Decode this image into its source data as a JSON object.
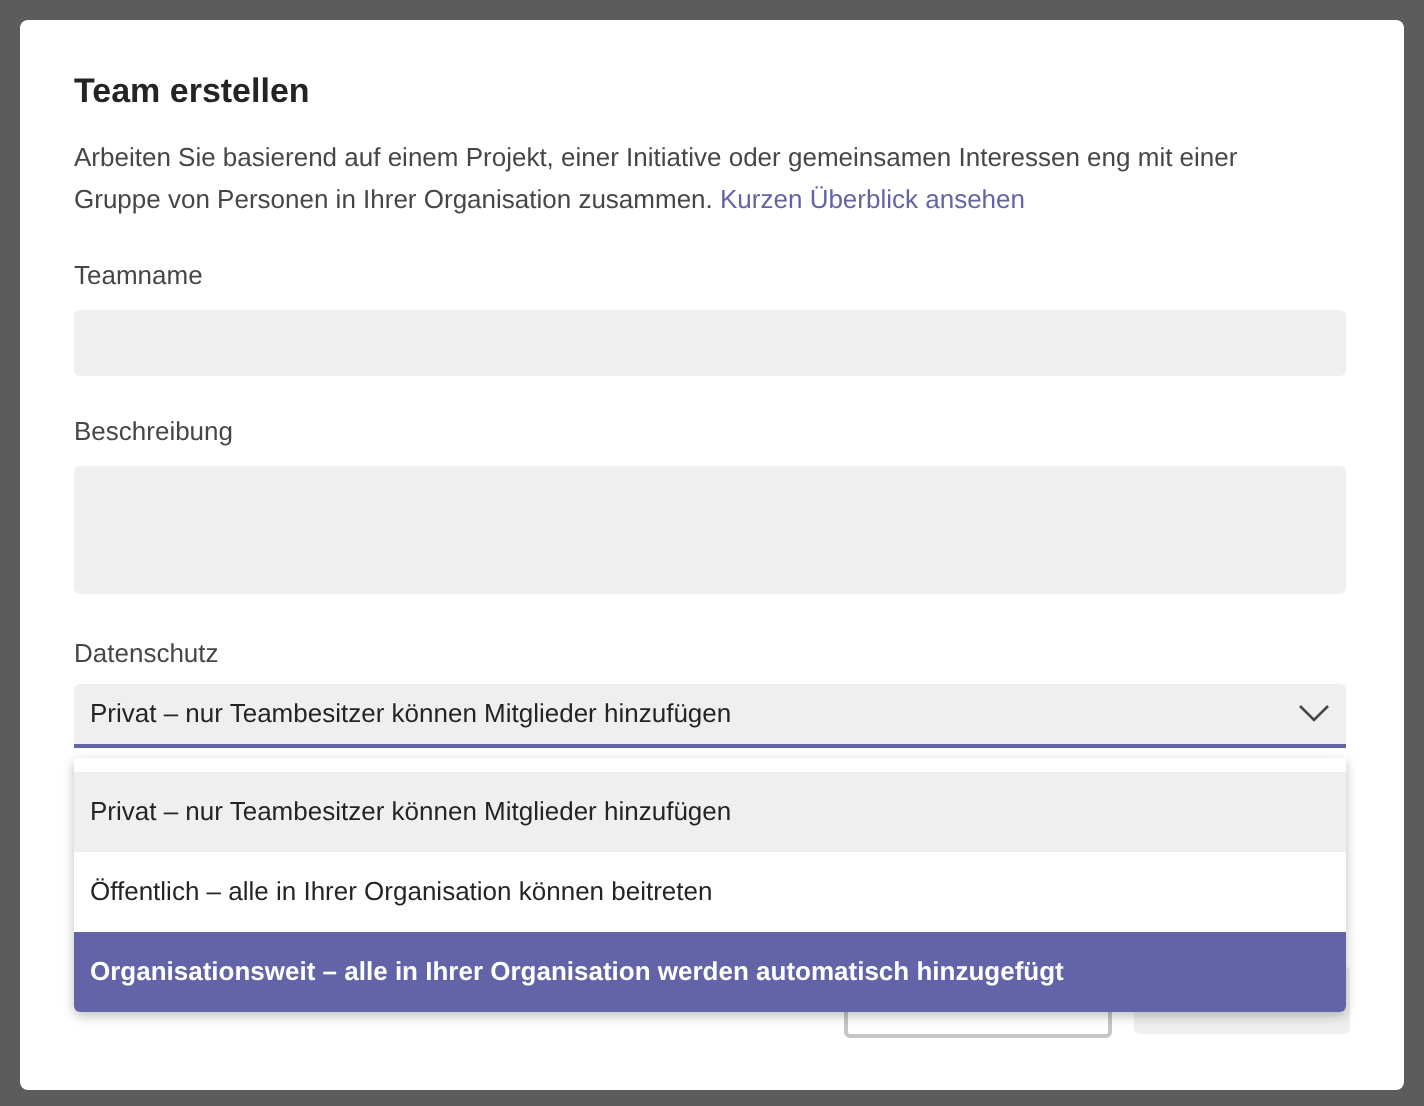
{
  "dialog": {
    "title": "Team erstellen",
    "description": "Arbeiten Sie basierend auf einem Projekt, einer Initiative oder gemeinsamen Interessen eng mit einer Gruppe von Personen in Ihrer Organisation zusammen.",
    "link": "Kurzen Überblick ansehen"
  },
  "fields": [
    {
      "label": "Teamname",
      "kind": "input"
    },
    {
      "label": "Beschreibung",
      "kind": "textarea"
    }
  ],
  "privacy": {
    "label": "Datenschutz",
    "value": "Privat – nur Teambesitzer können Mitglieder hinzufügen",
    "expanded": true,
    "options": [
      {
        "label": "Privat – nur Teambesitzer können Mitglieder hinzufügen",
        "highlighted": false,
        "selected": true
      },
      {
        "label": "Öffentlich – alle in Ihrer Organisation können beitreten",
        "highlighted": false,
        "selected": false
      },
      {
        "label": "Organisationsweit – alle in Ihrer Organisation werden automatisch hinzugefügt",
        "highlighted": true,
        "selected": false
      }
    ]
  }
}
